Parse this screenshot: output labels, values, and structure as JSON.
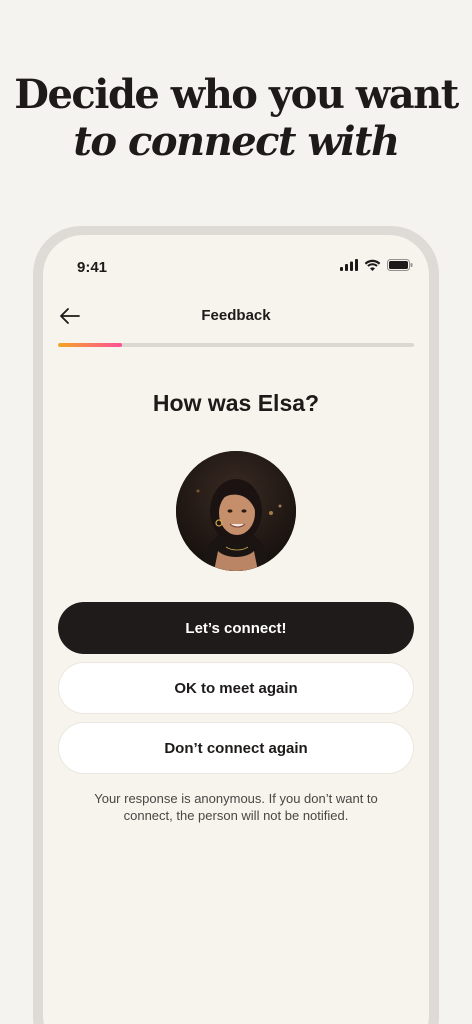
{
  "headline": {
    "line1": "Decide who you want",
    "line2": "to connect with"
  },
  "status_bar": {
    "time": "9:41",
    "icons": [
      "signal-icon",
      "wifi-icon",
      "battery-icon"
    ]
  },
  "nav": {
    "back_icon": "arrow-left-icon",
    "title": "Feedback"
  },
  "progress": {
    "value": 0.18
  },
  "question": "How was Elsa?",
  "avatar": {
    "alt": "Elsa"
  },
  "buttons": {
    "connect": "Let’s connect!",
    "ok_again": "OK to meet again",
    "dont_connect": "Don’t connect again"
  },
  "note": "Your response is anonymous. If you don’t want to connect, the person will not be notified.",
  "colors": {
    "background": "#f5f3ef",
    "primary": "#1f1b1a",
    "progress_start": "#f5a623",
    "progress_end": "#ff4f9a"
  }
}
